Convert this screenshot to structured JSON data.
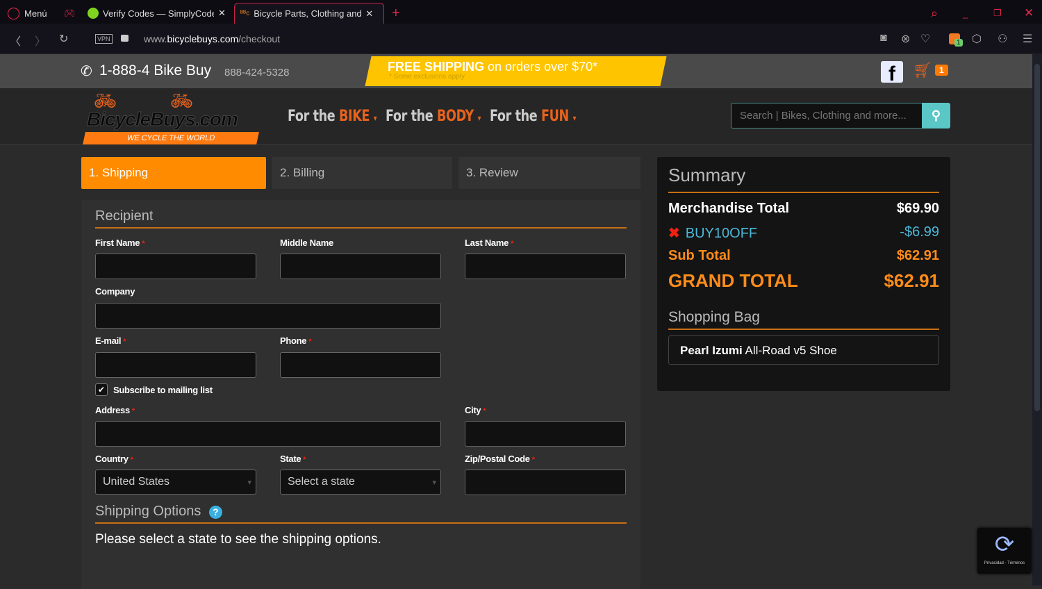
{
  "browser": {
    "menu": "Menú",
    "tabs": [
      {
        "title": "Verify Codes — SimplyCode"
      },
      {
        "title": "Bicycle Parts, Clothing and"
      }
    ],
    "url_prefix": "www.",
    "url_domain": "bicyclebuys.com",
    "url_path": "/checkout",
    "vpn": "VPN",
    "ext_badge": "1"
  },
  "topbar": {
    "phone_vanity": "1-888-4 Bike Buy",
    "phone_number": "888-424-5328",
    "promo_bold": "FREE SHIPPING",
    "promo_rest": " on orders over $70*",
    "promo_note": "* Some exclusions apply",
    "cart_count": "1"
  },
  "header": {
    "logo_text": "BicycleBuys.com",
    "tagline": "WE CYCLE THE WORLD",
    "nav": [
      {
        "prefix": "For the ",
        "accent": "BIKE"
      },
      {
        "prefix": "For the ",
        "accent": "BODY"
      },
      {
        "prefix": "For the ",
        "accent": "FUN"
      }
    ],
    "search_placeholder": "Search | Bikes, Clothing and more..."
  },
  "steps": [
    "1. Shipping",
    "2. Billing",
    "3. Review"
  ],
  "form": {
    "recipient_title": "Recipient",
    "first_name": "First Name",
    "middle_name": "Middle Name",
    "last_name": "Last Name",
    "company": "Company",
    "email": "E-mail",
    "phone": "Phone",
    "subscribe": "Subscribe to mailing list",
    "address": "Address",
    "city": "City",
    "country": "Country",
    "country_value": "United States",
    "state": "State",
    "state_value": "Select a state",
    "zip": "Zip/Postal Code",
    "required": "*",
    "shipping_title": "Shipping Options",
    "shipping_msg": "Please select a state to see the shipping options."
  },
  "summary": {
    "title": "Summary",
    "merch_label": "Merchandise Total",
    "merch_value": "$69.90",
    "coupon_code": "BUY10OFF",
    "coupon_value": "-$6.99",
    "sub_label": "Sub Total",
    "sub_value": "$62.91",
    "grand_label": "GRAND TOTAL",
    "grand_value": "$62.91",
    "bag_title": "Shopping Bag",
    "item_brand": "Pearl Izumi",
    "item_name": " All-Road v5 Shoe"
  },
  "recaptcha": {
    "text": "Privacidad - Términos"
  },
  "colors": {
    "accent": "#ff8c00",
    "teal": "#5bc6c6",
    "coupon": "#4bb8d8"
  }
}
